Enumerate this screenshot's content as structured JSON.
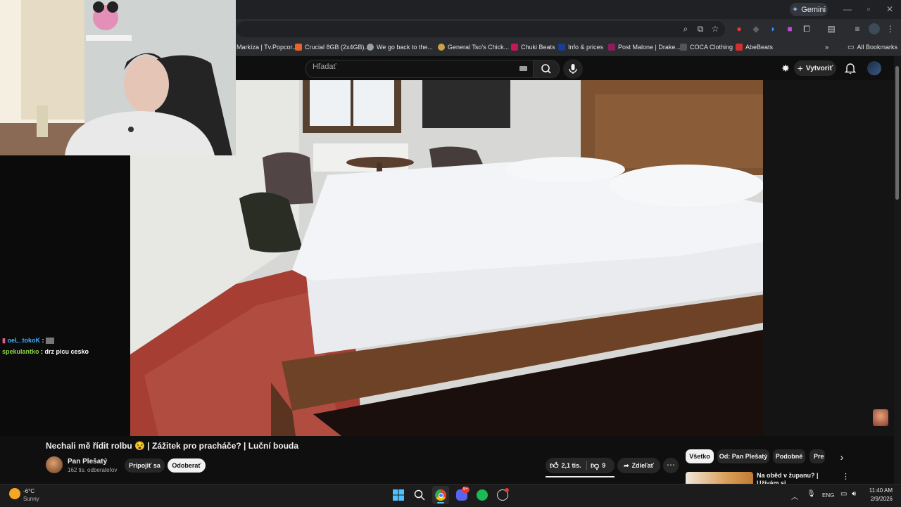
{
  "browser": {
    "gemini_label": "Gemini",
    "bookmarks": [
      {
        "label": "Markíza | Tv.Popcor...",
        "color": "#2a2c30"
      },
      {
        "label": "Crucial 8GB (2x4GB)...",
        "color": "#e8642a"
      },
      {
        "label": "We go back to the...",
        "color": "#9aa0a6"
      },
      {
        "label": "General Tso's Chick...",
        "color": "#c9a24a"
      },
      {
        "label": "Chuki Beats",
        "color": "#c2185b"
      },
      {
        "label": "Info & prices",
        "color": "#1a3d8f"
      },
      {
        "label": "Post Malone | Drake...",
        "color": "#8e1b5a"
      },
      {
        "label": "COCA Clothing",
        "color": "#333333"
      },
      {
        "label": "AbeBeats",
        "color": "#d32f2f"
      }
    ],
    "all_bookmarks_label": "All Bookmarks"
  },
  "youtube": {
    "search_placeholder": "Hľadať",
    "create_label": "Vytvoriť",
    "video_title": "Nechali mě řídit rolbu 😵 | Zážitek pro pracháče? | Luční bouda",
    "channel_name": "Pan Plešatý",
    "channel_subs": "162 tis. odberateľov",
    "join_label": "Pripojiť sa",
    "subscribe_label": "Odoberať",
    "likes": "2,1 tis.",
    "dislikes": "9",
    "share_label": "Zdieľať",
    "chips": [
      "Všetko",
      "Od: Pan Plešatý",
      "Podobné",
      "Pre"
    ],
    "rec_title": "Na oběd v županu? | Užívám si"
  },
  "chat": [
    {
      "user": "oeL_tokoK",
      "text": "",
      "color": "#3bb0ff"
    },
    {
      "user": "spekulantko",
      "text": "drz picu cesko",
      "color": "#8bd34a"
    }
  ],
  "taskbar": {
    "temp": "-6°C",
    "weather": "Sunny",
    "lang": "ENG",
    "time": "11:40 AM",
    "date": "2/9/2026",
    "discord_badge": "9+"
  }
}
